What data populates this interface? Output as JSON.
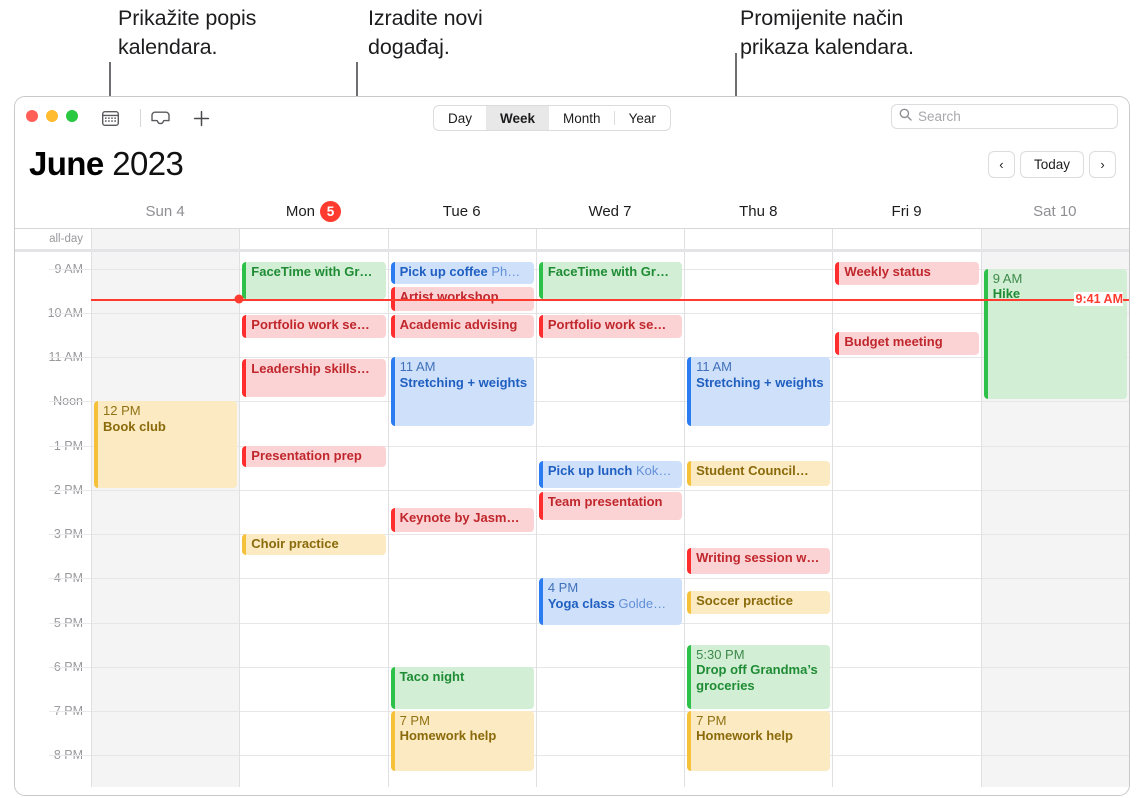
{
  "callouts": [
    {
      "text": "Prikažite popis\nkalendara.",
      "name": "callout-show-calendar-list"
    },
    {
      "text": "Izradite novi\ndogađaj.",
      "name": "callout-create-new-event"
    },
    {
      "text": "Promijenite način\nprikaza kalendara.",
      "name": "callout-change-calendar-view"
    }
  ],
  "toolbar": {
    "calendar_list_icon": "calendar-icon",
    "inbox_icon": "inbox-icon",
    "add_icon": "plus-icon",
    "views": [
      {
        "label": "Day",
        "selected": false
      },
      {
        "label": "Week",
        "selected": true
      },
      {
        "label": "Month",
        "selected": false
      },
      {
        "label": "Year",
        "selected": false
      }
    ],
    "search_placeholder": "Search",
    "search_icon": "search-icon"
  },
  "header": {
    "month": "June",
    "year": "2023",
    "prev_label": "‹",
    "today_label": "Today",
    "next_label": "›"
  },
  "days": [
    {
      "label": "Sun 4",
      "name": "sun",
      "weekend": true,
      "today": false,
      "badge": ""
    },
    {
      "label": "Mon",
      "name": "mon",
      "weekend": false,
      "today": true,
      "badge": "5"
    },
    {
      "label": "Tue 6",
      "name": "tue",
      "weekend": false,
      "today": false,
      "badge": ""
    },
    {
      "label": "Wed 7",
      "name": "wed",
      "weekend": false,
      "today": false,
      "badge": ""
    },
    {
      "label": "Thu 8",
      "name": "thu",
      "weekend": false,
      "today": false,
      "badge": ""
    },
    {
      "label": "Fri 9",
      "name": "fri",
      "weekend": false,
      "today": false,
      "badge": ""
    },
    {
      "label": "Sat 10",
      "name": "sat",
      "weekend": true,
      "today": false,
      "badge": ""
    }
  ],
  "allday_label": "all-day",
  "hours": [
    {
      "label": "9 AM",
      "hour": 9
    },
    {
      "label": "10 AM",
      "hour": 10
    },
    {
      "label": "11 AM",
      "hour": 11
    },
    {
      "label": "Noon",
      "hour": 12
    },
    {
      "label": "1 PM",
      "hour": 13
    },
    {
      "label": "2 PM",
      "hour": 14
    },
    {
      "label": "3 PM",
      "hour": 15
    },
    {
      "label": "4 PM",
      "hour": 16
    },
    {
      "label": "5 PM",
      "hour": 17
    },
    {
      "label": "6 PM",
      "hour": 18
    },
    {
      "label": "7 PM",
      "hour": 19
    },
    {
      "label": "8 PM",
      "hour": 20
    }
  ],
  "now": {
    "label": "9:41 AM",
    "hour": 9,
    "minute": 41,
    "day_index": 1
  },
  "colors": {
    "today_badge": "#ff3b30",
    "now_line": "#ff3b30",
    "red": "#ff2d2d",
    "green": "#2ec14a",
    "blue": "#2b7cf0",
    "yellow": "#f5c13a"
  },
  "events": [
    {
      "day": 0,
      "start": 12.0,
      "end": 14.0,
      "color": "yellow",
      "time": "12 PM",
      "title": "Book club",
      "sub": "",
      "wrap": true
    },
    {
      "day": 1,
      "start": 8.85,
      "end": 9.72,
      "color": "green",
      "time": "",
      "title": "FaceTime with Gr…",
      "sub": "",
      "wrap": false
    },
    {
      "day": 1,
      "start": 10.05,
      "end": 10.62,
      "color": "red",
      "time": "",
      "title": "Portfolio work se…",
      "sub": "",
      "wrap": false
    },
    {
      "day": 1,
      "start": 11.05,
      "end": 11.95,
      "color": "red",
      "time": "",
      "title": "Leadership skills…",
      "sub": "",
      "wrap": false
    },
    {
      "day": 1,
      "start": 13.0,
      "end": 13.52,
      "color": "red",
      "time": "",
      "title": "Presentation prep",
      "sub": "",
      "wrap": false
    },
    {
      "day": 1,
      "start": 15.0,
      "end": 15.52,
      "color": "yellow",
      "time": "",
      "title": "Choir practice",
      "sub": "",
      "wrap": false
    },
    {
      "day": 2,
      "start": 8.85,
      "end": 9.38,
      "color": "blue",
      "time": "",
      "title": "Pick up coffee",
      "sub": "Ph…",
      "wrap": false
    },
    {
      "day": 2,
      "start": 9.42,
      "end": 10.0,
      "color": "red",
      "time": "",
      "title": "Artist workshop…",
      "sub": "",
      "wrap": false
    },
    {
      "day": 2,
      "start": 10.05,
      "end": 10.62,
      "color": "red",
      "time": "",
      "title": "Academic advising",
      "sub": "",
      "wrap": false
    },
    {
      "day": 2,
      "start": 11.0,
      "end": 12.6,
      "color": "blue",
      "time": "11 AM",
      "title": "Stretching + weights",
      "sub": "",
      "wrap": true
    },
    {
      "day": 2,
      "start": 14.4,
      "end": 15.0,
      "color": "red",
      "time": "",
      "title": "Keynote by Jasm…",
      "sub": "",
      "wrap": false
    },
    {
      "day": 2,
      "start": 18.0,
      "end": 19.0,
      "color": "green",
      "time": "",
      "title": "Taco night",
      "sub": "",
      "wrap": false
    },
    {
      "day": 2,
      "start": 19.0,
      "end": 20.4,
      "color": "yellow",
      "time": "7 PM",
      "title": "Homework help",
      "sub": "",
      "wrap": true
    },
    {
      "day": 3,
      "start": 8.85,
      "end": 9.72,
      "color": "green",
      "time": "",
      "title": "FaceTime with Gr…",
      "sub": "",
      "wrap": false
    },
    {
      "day": 3,
      "start": 10.05,
      "end": 10.62,
      "color": "red",
      "time": "",
      "title": "Portfolio work se…",
      "sub": "",
      "wrap": false
    },
    {
      "day": 3,
      "start": 13.35,
      "end": 14.0,
      "color": "blue",
      "time": "",
      "title": "Pick up lunch",
      "sub": "Kok…",
      "wrap": false
    },
    {
      "day": 3,
      "start": 14.05,
      "end": 14.72,
      "color": "red",
      "time": "",
      "title": "Team presentation",
      "sub": "",
      "wrap": false
    },
    {
      "day": 3,
      "start": 16.0,
      "end": 17.1,
      "color": "blue",
      "time": "4 PM",
      "title": "Yoga class",
      "sub": "Golde…",
      "wrap": false
    },
    {
      "day": 4,
      "start": 11.0,
      "end": 12.6,
      "color": "blue",
      "time": "11 AM",
      "title": "Stretching + weights",
      "sub": "",
      "wrap": true
    },
    {
      "day": 4,
      "start": 13.35,
      "end": 13.95,
      "color": "yellow",
      "time": "",
      "title": "Student Council…",
      "sub": "",
      "wrap": false
    },
    {
      "day": 4,
      "start": 15.32,
      "end": 15.95,
      "color": "red",
      "time": "",
      "title": "Writing session w…",
      "sub": "",
      "wrap": false
    },
    {
      "day": 4,
      "start": 16.28,
      "end": 16.85,
      "color": "yellow",
      "time": "",
      "title": "Soccer practice",
      "sub": "",
      "wrap": false
    },
    {
      "day": 4,
      "start": 17.5,
      "end": 19.0,
      "color": "green",
      "time": "5:30 PM",
      "title": "Drop off Grandma’s groceries",
      "sub": "",
      "wrap": true
    },
    {
      "day": 4,
      "start": 19.0,
      "end": 20.4,
      "color": "yellow",
      "time": "7 PM",
      "title": "Homework help",
      "sub": "",
      "wrap": true
    },
    {
      "day": 5,
      "start": 8.85,
      "end": 9.42,
      "color": "red",
      "time": "",
      "title": "Weekly status",
      "sub": "",
      "wrap": false
    },
    {
      "day": 5,
      "start": 10.42,
      "end": 11.0,
      "color": "red",
      "time": "",
      "title": "Budget meeting",
      "sub": "",
      "wrap": false
    },
    {
      "day": 6,
      "start": 9.0,
      "end": 12.0,
      "color": "green",
      "time": "9 AM",
      "title": "Hike",
      "sub": "",
      "wrap": true
    }
  ]
}
